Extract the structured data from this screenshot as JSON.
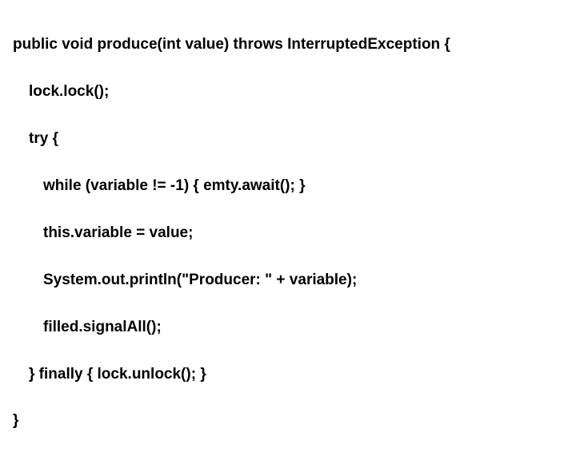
{
  "code": {
    "line1": "public void produce(int value) throws InterruptedException {",
    "line2": "lock.lock();",
    "line3": "try {",
    "line4": "while (variable != -1) { emty.await(); }",
    "line5": "this.variable = value;",
    "line6": "System.out.println(\"Producer: \" + variable);",
    "line7": "filled.signalAll();",
    "line8": "} finally { lock.unlock(); }",
    "line9": "}"
  }
}
